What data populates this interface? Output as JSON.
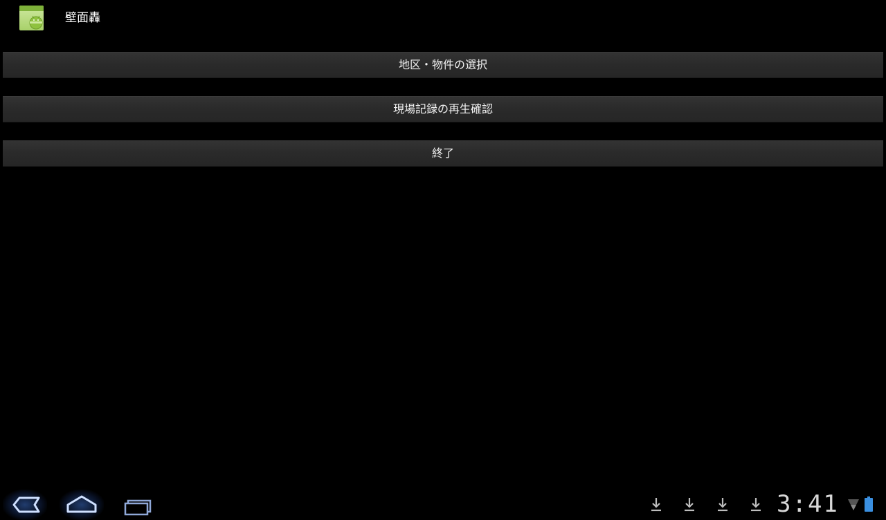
{
  "app": {
    "title": "壁面轟",
    "icon": "android-icon"
  },
  "menu": {
    "buttons": [
      {
        "label": "地区・物件の選択"
      },
      {
        "label": "現場記録の再生確認"
      },
      {
        "label": "終了"
      }
    ]
  },
  "system_bar": {
    "clock": "3:41",
    "notifications": [
      "download-icon",
      "download-icon",
      "download-icon",
      "download-icon"
    ],
    "status_icons": [
      "wifi-icon",
      "battery-icon"
    ],
    "nav": [
      "back-icon",
      "home-icon",
      "recent-apps-icon"
    ],
    "accent_color": "#3a6fd0"
  }
}
